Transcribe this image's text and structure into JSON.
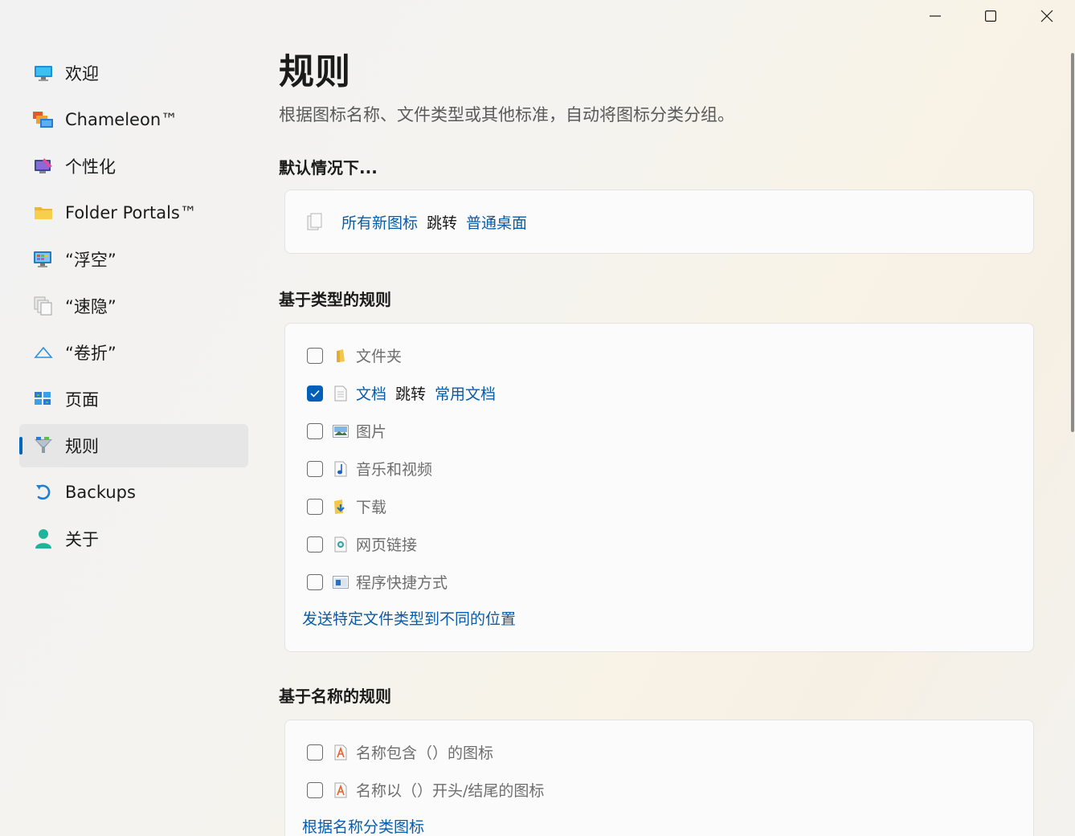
{
  "window": {
    "controls": {
      "minimize": "minimize",
      "maximize": "maximize",
      "close": "close"
    }
  },
  "sidebar": {
    "items": [
      {
        "label": "欢迎",
        "icon": "monitor-icon"
      },
      {
        "label": "Chameleon™",
        "icon": "chameleon-icon"
      },
      {
        "label": "个性化",
        "icon": "personalize-icon"
      },
      {
        "label": "Folder Portals™",
        "icon": "folder-icon"
      },
      {
        "label": "“浮空”",
        "icon": "float-icon"
      },
      {
        "label": "“速隐”",
        "icon": "quick-hide-icon"
      },
      {
        "label": "“卷折”",
        "icon": "roll-up-icon"
      },
      {
        "label": "页面",
        "icon": "pages-icon"
      },
      {
        "label": "规则",
        "icon": "rules-icon",
        "active": true
      },
      {
        "label": "Backups",
        "icon": "backup-icon"
      },
      {
        "label": "关于",
        "icon": "about-icon"
      }
    ]
  },
  "main": {
    "title": "规则",
    "subtitle": "根据图标名称、文件类型或其他标准，自动将图标分类分组。",
    "default_section": {
      "title": "默认情况下...",
      "source": "所有新图标",
      "verb": "跳转",
      "target": "普通桌面"
    },
    "type_section": {
      "title": "基于类型的规则",
      "rows": [
        {
          "label": "文件夹",
          "checked": false,
          "icon": "folder-icon"
        },
        {
          "label": "文档",
          "checked": true,
          "icon": "document-icon",
          "verb": "跳转",
          "target": "常用文档"
        },
        {
          "label": "图片",
          "checked": false,
          "icon": "picture-icon"
        },
        {
          "label": "音乐和视频",
          "checked": false,
          "icon": "music-icon"
        },
        {
          "label": "下载",
          "checked": false,
          "icon": "download-icon"
        },
        {
          "label": "网页链接",
          "checked": false,
          "icon": "weblink-icon"
        },
        {
          "label": "程序快捷方式",
          "checked": false,
          "icon": "shortcut-icon"
        }
      ],
      "link": "发送特定文件类型到不同的位置"
    },
    "name_section": {
      "title": "基于名称的规则",
      "rows": [
        {
          "label": "名称包含（）的图标",
          "checked": false,
          "icon": "name-rule-icon"
        },
        {
          "label": "名称以（）开头/结尾的图标",
          "checked": false,
          "icon": "name-rule-icon"
        }
      ],
      "link": "根据名称分类图标"
    }
  },
  "colors": {
    "accent": "#005fb8",
    "link": "#0a5ca8"
  }
}
